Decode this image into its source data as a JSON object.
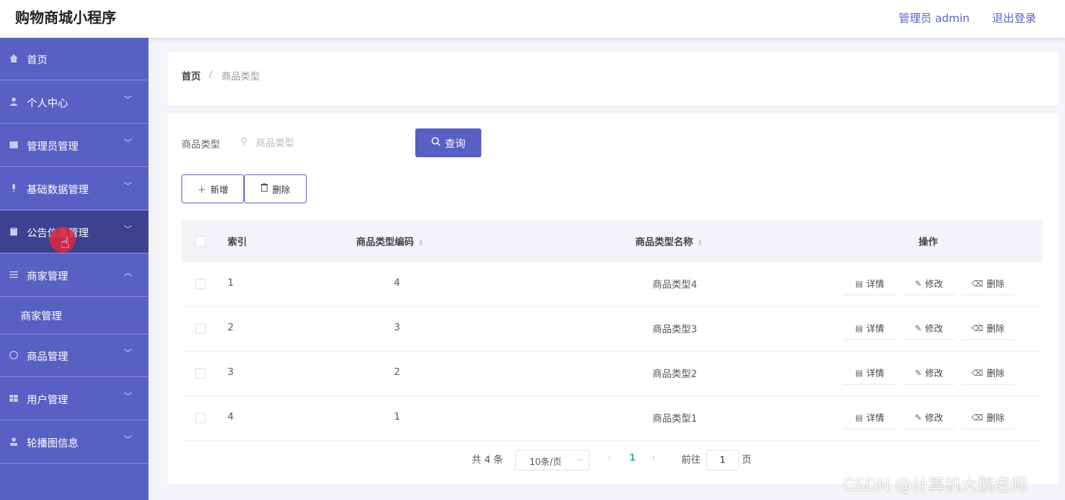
{
  "header": {
    "app_title": "购物商城小程序",
    "admin_label": "管理员 admin",
    "logout_label": "退出登录"
  },
  "sidebar": {
    "items": [
      {
        "label": "首页",
        "icon": "home-icon",
        "expandable": false
      },
      {
        "label": "个人中心",
        "icon": "user-icon",
        "expandable": true
      },
      {
        "label": "管理员管理",
        "icon": "admin-icon",
        "expandable": true
      },
      {
        "label": "基础数据管理",
        "icon": "mic-icon",
        "expandable": true
      },
      {
        "label": "公告信息管理",
        "icon": "clipboard-icon",
        "expandable": true,
        "active": true
      },
      {
        "label": "商家管理",
        "icon": "list-icon",
        "expandable": true,
        "expanded": true
      },
      {
        "label": "商品管理",
        "icon": "compass-icon",
        "expandable": true
      },
      {
        "label": "用户管理",
        "icon": "grid-icon",
        "expandable": true
      },
      {
        "label": "轮播图信息",
        "icon": "person-icon",
        "expandable": true
      }
    ],
    "sub_item_label": "商家管理"
  },
  "breadcrumb": {
    "home": "首页",
    "separator": "/",
    "current": "商品类型"
  },
  "search": {
    "label": "商品类型",
    "placeholder": "商品类型",
    "query_label": "查询"
  },
  "actions": {
    "add_label": "新增",
    "delete_label": "删除"
  },
  "table": {
    "columns": {
      "index": "索引",
      "code": "商品类型编码",
      "name": "商品类型名称",
      "ops": "操作"
    },
    "rows": [
      {
        "index": "1",
        "code": "4",
        "name": "商品类型4"
      },
      {
        "index": "2",
        "code": "3",
        "name": "商品类型3"
      },
      {
        "index": "3",
        "code": "2",
        "name": "商品类型2"
      },
      {
        "index": "4",
        "code": "1",
        "name": "商品类型1"
      }
    ],
    "op_labels": {
      "detail": "详情",
      "edit": "修改",
      "delete": "删除"
    }
  },
  "pagination": {
    "total": "共 4 条",
    "page_size": "10条/页",
    "current_page": "1",
    "goto_label": "前往",
    "goto_value": "1",
    "page_unit": "页"
  },
  "watermark": "CSDN @计算机大鹅老师",
  "colors": {
    "accent": "#5860c4",
    "sidebar_active": "#3c4190",
    "page_current": "#3bb8a0"
  }
}
